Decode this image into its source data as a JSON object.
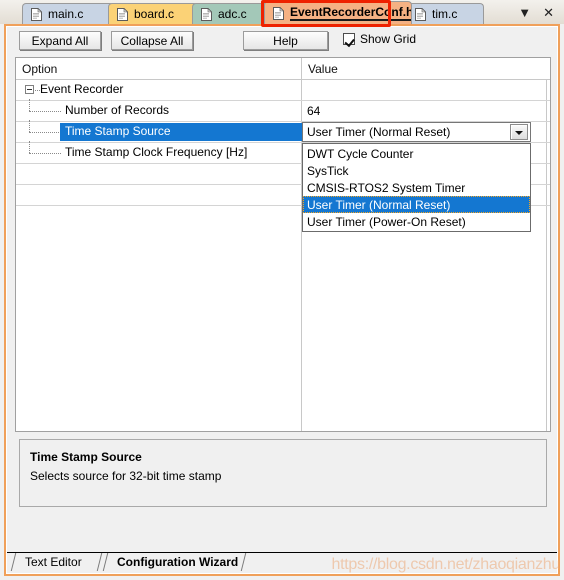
{
  "editor_tabs": [
    {
      "label": "main.c",
      "color": "#c8d4e4",
      "active": false,
      "icon": "document-icon"
    },
    {
      "label": "board.c",
      "color": "#fbd276",
      "active": false,
      "icon": "document-icon"
    },
    {
      "label": "adc.c",
      "color": "#a3c8b8",
      "active": false,
      "icon": "document-icon"
    },
    {
      "label": "EventRecorderConf.h",
      "color": "#f5b183",
      "active": true,
      "icon": "document-icon"
    },
    {
      "label": "tim.c",
      "color": "#c8d4e4",
      "active": false,
      "icon": "document-icon"
    }
  ],
  "tab_nav": {
    "dropdown_glyph": "▼",
    "close_glyph": "✕"
  },
  "highlight_color": "#ee2200",
  "toolbar": {
    "expand_all_label": "Expand All",
    "collapse_all_label": "Collapse All",
    "help_label": "Help",
    "show_grid_label": "Show Grid",
    "show_grid_checked": true
  },
  "grid": {
    "columns": [
      "Option",
      "Value"
    ],
    "rows": [
      {
        "option": "Event Recorder",
        "value": "",
        "level": 0,
        "expandable": true,
        "expanded": true,
        "selected": false
      },
      {
        "option": "Number of Records",
        "value": "64",
        "level": 1,
        "expandable": false,
        "expanded": false,
        "selected": false
      },
      {
        "option": "Time Stamp Source",
        "value": "",
        "level": 1,
        "expandable": false,
        "expanded": false,
        "selected": true
      },
      {
        "option": "Time Stamp Clock Frequency [Hz]",
        "value": "",
        "level": 1,
        "expandable": false,
        "expanded": false,
        "selected": false
      }
    ]
  },
  "combo": {
    "selected_value": "User Timer (Normal Reset)",
    "options": [
      "DWT Cycle Counter",
      "SysTick",
      "CMSIS-RTOS2 System Timer",
      "User Timer (Normal Reset)",
      "User Timer (Power-On Reset)"
    ],
    "selected_index": 3,
    "open": true,
    "highlight_color": "#1477d1"
  },
  "description": {
    "title": "Time Stamp Source",
    "text": "Selects source for 32-bit time stamp"
  },
  "bottom_tabs": [
    {
      "label": "Text Editor",
      "active": false
    },
    {
      "label": "Configuration Wizard",
      "active": true
    }
  ],
  "watermark": "https://blog.csdn.net/zhaoqianzhu"
}
